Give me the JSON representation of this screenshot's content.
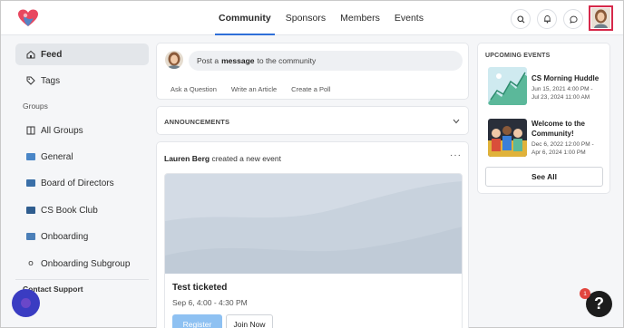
{
  "nav": {
    "items": [
      {
        "label": "Community",
        "active": true
      },
      {
        "label": "Sponsors",
        "active": false
      },
      {
        "label": "Members",
        "active": false
      },
      {
        "label": "Events",
        "active": false
      }
    ]
  },
  "header_icons": [
    "search-icon",
    "bell-icon",
    "chat-icon"
  ],
  "sidebar": {
    "feed_label": "Feed",
    "tags_label": "Tags",
    "groups_heading": "Groups",
    "all_groups_label": "All Groups",
    "groups": [
      {
        "label": "General",
        "color": "#4a86c7"
      },
      {
        "label": "Board of Directors",
        "color": "#3a6fa8"
      },
      {
        "label": "CS Book Club",
        "color": "#2f5d8f"
      },
      {
        "label": "Onboarding",
        "color": "#4b7fb8"
      },
      {
        "label": "Onboarding Subgroup",
        "color": "#555555"
      }
    ],
    "contact_heading": "Contact Support"
  },
  "composer": {
    "prefix": "Post a",
    "bold": "message",
    "suffix": "to the community",
    "actions": [
      "Ask a Question",
      "Write an Article",
      "Create a Poll"
    ]
  },
  "announcements": {
    "label": "ANNOUNCEMENTS"
  },
  "post": {
    "author": "Lauren Berg",
    "action": "created a new event",
    "event_title": "Test ticketed",
    "event_date": "Sep 6, 4:00 - 4:30 PM",
    "register_label": "Register",
    "join_label": "Join Now"
  },
  "upcoming": {
    "title": "UPCOMING EVENTS",
    "events": [
      {
        "name": "CS Morning Huddle",
        "date_start": "Jun 15, 2021 4:00 PM -",
        "date_end": "Jul 23, 2024 11:00 AM"
      },
      {
        "name_line1": "Welcome to the",
        "name_line2": "Community!",
        "date_start": "Dec 6, 2022 12:00 PM -",
        "date_end": "Apr 6, 2024 1:00 PM"
      }
    ],
    "see_all_label": "See All"
  },
  "help": {
    "badge": "1",
    "symbol": "?"
  },
  "colors": {
    "accent": "#2f6fd8",
    "register_button": "#8ec1f2",
    "profile_highlight": "#d6294a"
  }
}
